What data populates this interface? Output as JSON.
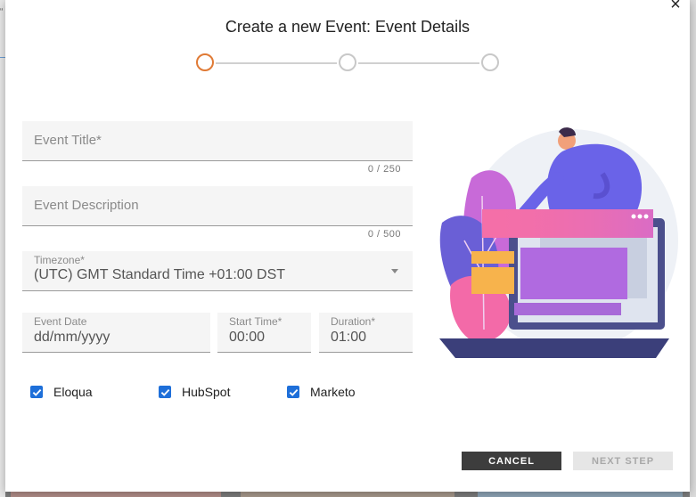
{
  "dialog": {
    "title": "Create a new Event: Event Details",
    "close_label": "×"
  },
  "stepper": {
    "steps": 3,
    "active_step": 1
  },
  "form": {
    "event_title": {
      "placeholder": "Event Title*",
      "counter": "0 / 250"
    },
    "event_description": {
      "placeholder": "Event Description",
      "counter": "0 / 500"
    },
    "timezone": {
      "label": "Timezone*",
      "value": "(UTC) GMT Standard Time +01:00 DST"
    },
    "event_date": {
      "label": "Event Date",
      "value": "dd/mm/yyyy"
    },
    "start_time": {
      "label": "Start Time*",
      "value": "00:00"
    },
    "duration": {
      "label": "Duration*",
      "value": "01:00"
    }
  },
  "integrations": [
    {
      "label": "Eloqua",
      "checked": true
    },
    {
      "label": "HubSpot",
      "checked": true
    },
    {
      "label": "Marketo",
      "checked": true
    }
  ],
  "buttons": {
    "cancel": "CANCEL",
    "next_step": "NEXT STEP"
  },
  "colors": {
    "active_step": "#e07a35",
    "checkbox": "#1e6fd9",
    "cancel_bg": "#3d3d3d"
  }
}
